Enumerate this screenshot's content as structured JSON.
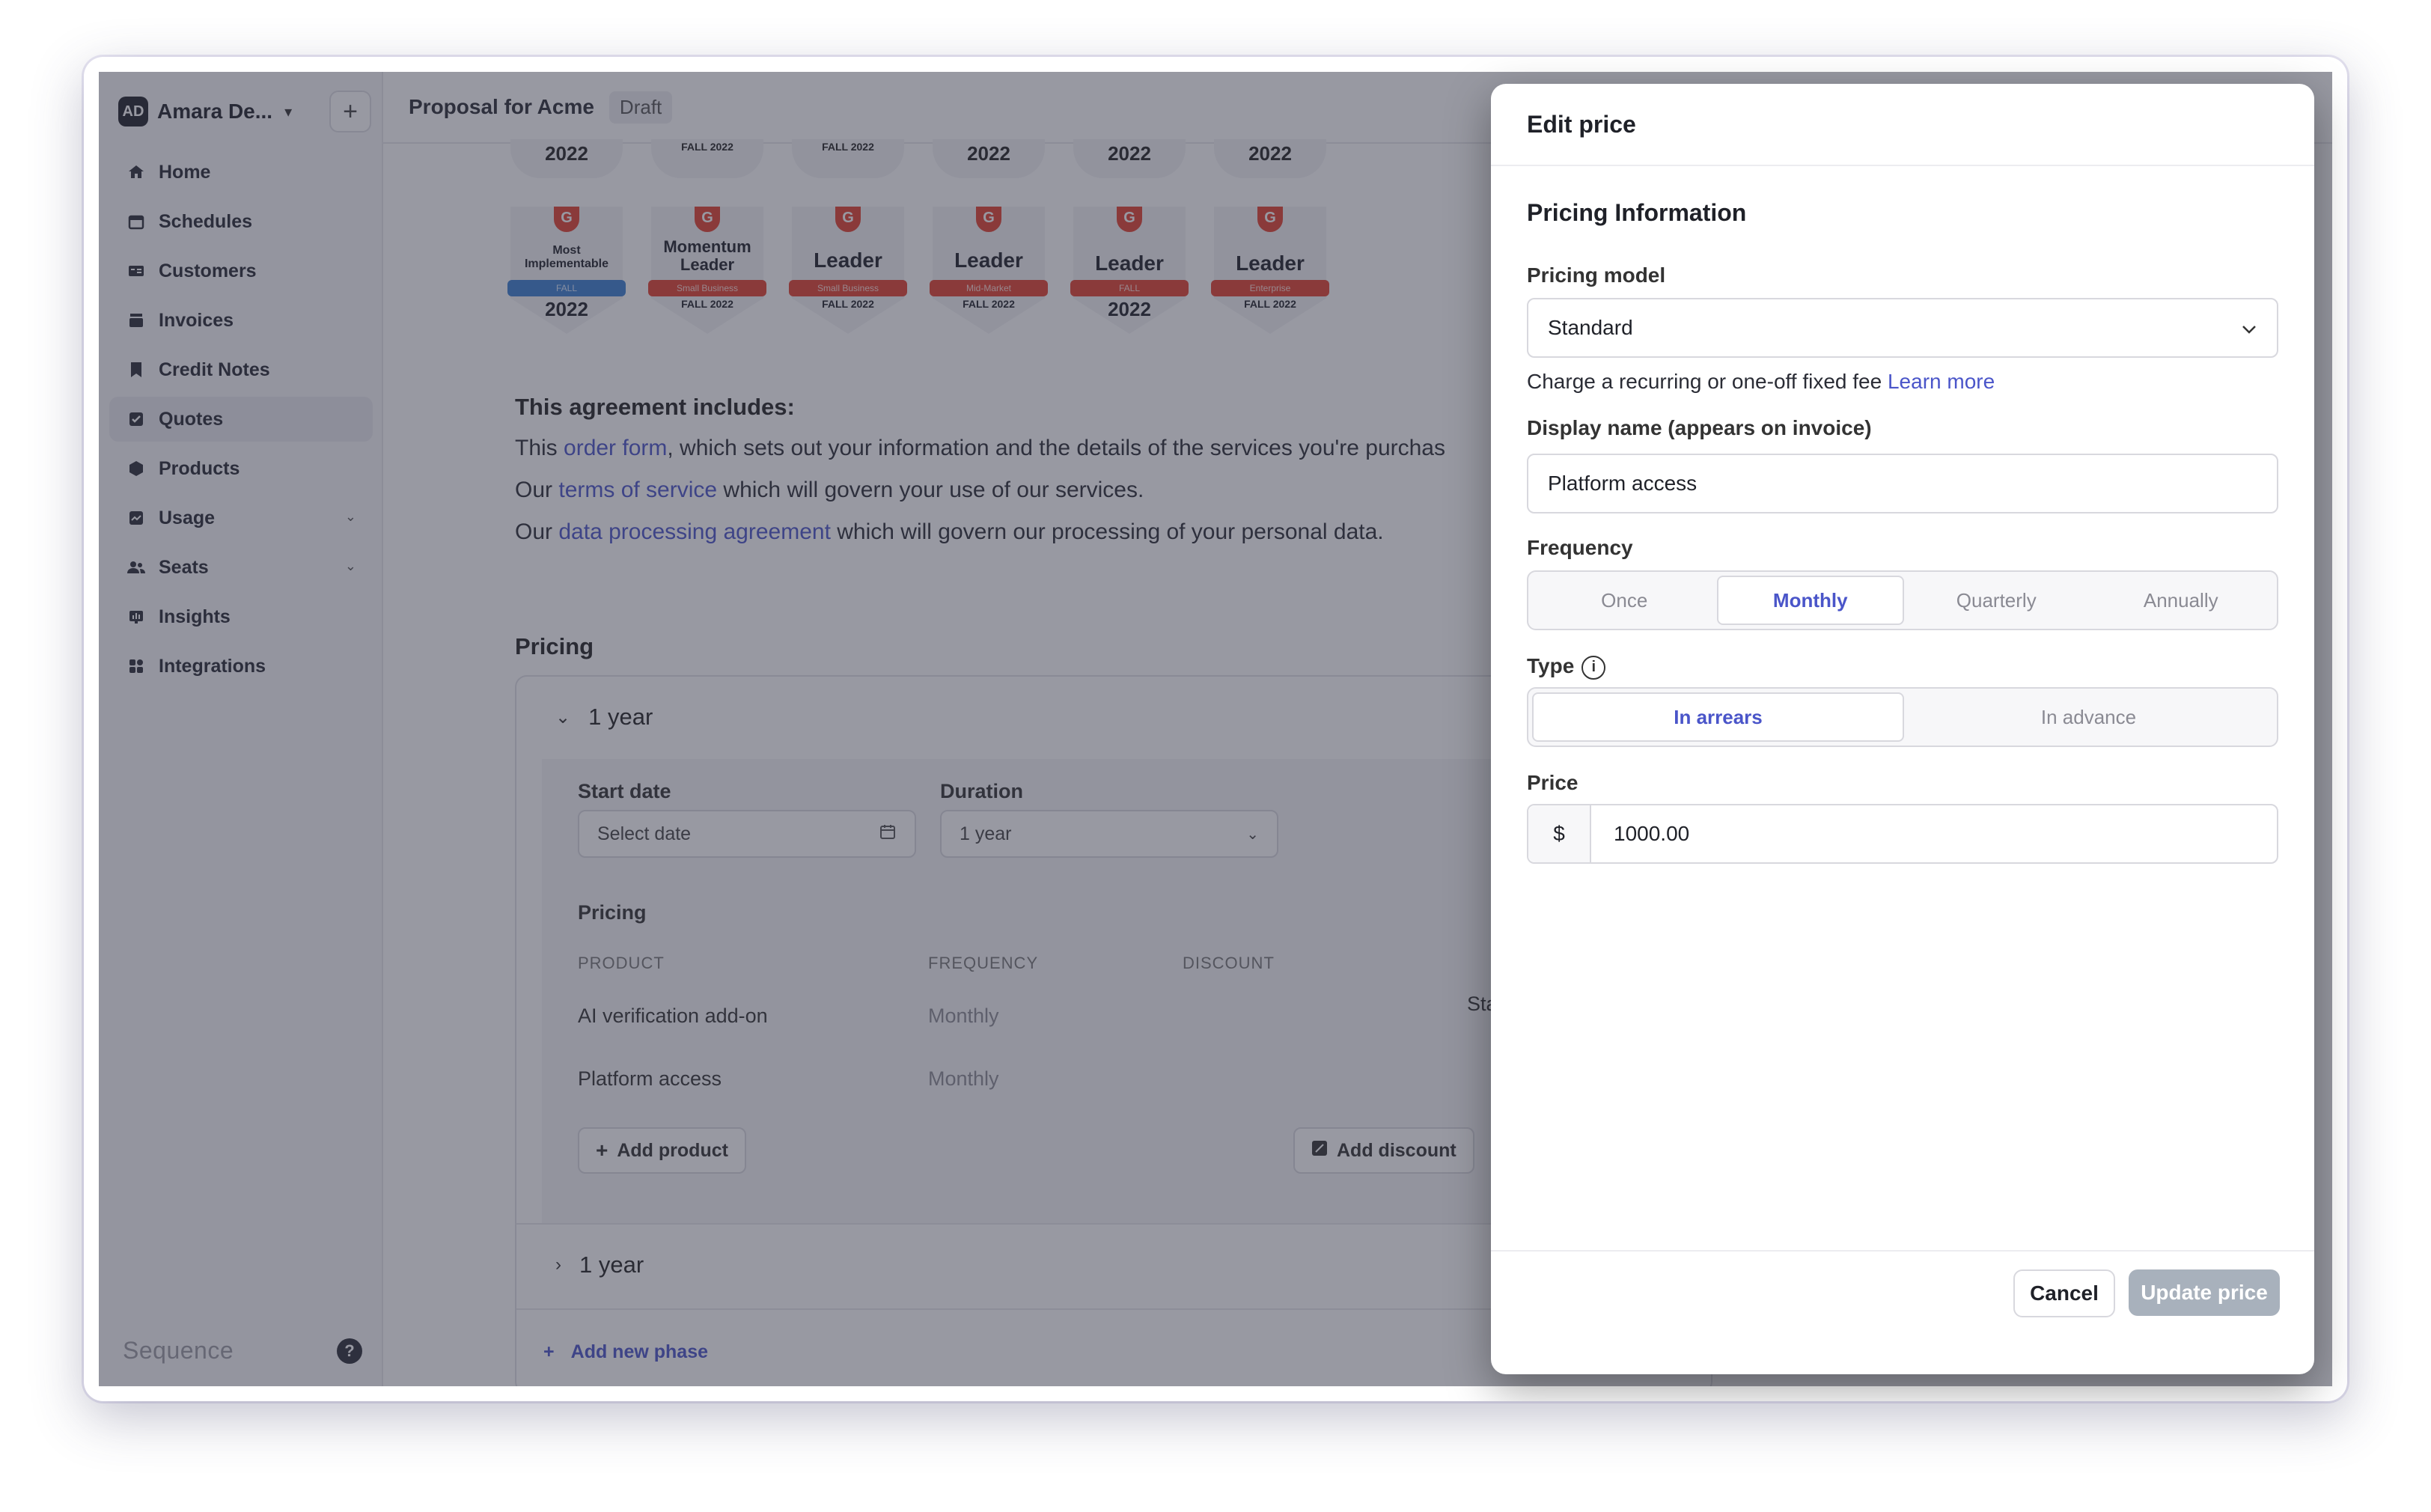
{
  "workspace": {
    "avatar": "AD",
    "name": "Amara De..."
  },
  "sidebar": {
    "items": [
      {
        "label": "Home",
        "icon": "home-icon"
      },
      {
        "label": "Schedules",
        "icon": "calendar-icon"
      },
      {
        "label": "Customers",
        "icon": "id-card-icon"
      },
      {
        "label": "Invoices",
        "icon": "invoice-icon"
      },
      {
        "label": "Credit Notes",
        "icon": "note-icon"
      },
      {
        "label": "Quotes",
        "icon": "checkbox-icon"
      },
      {
        "label": "Products",
        "icon": "cube-icon"
      },
      {
        "label": "Usage",
        "icon": "chart-icon"
      },
      {
        "label": "Seats",
        "icon": "users-icon"
      },
      {
        "label": "Insights",
        "icon": "insights-icon"
      },
      {
        "label": "Integrations",
        "icon": "grid-icon"
      }
    ],
    "brand": "Sequence",
    "help": "?"
  },
  "header": {
    "title": "Proposal for Acme",
    "status": "Draft"
  },
  "badges_top": [
    "2022",
    "FALL 2022",
    "FALL 2022",
    "2022",
    "2022",
    "2022"
  ],
  "badges": [
    {
      "name": "Most Implementable",
      "ribbon": "FALL",
      "year": "2022"
    },
    {
      "name": "Momentum Leader",
      "ribbon": "Small Business",
      "year": "FALL 2022"
    },
    {
      "name": "Leader",
      "ribbon": "Small Business",
      "year": "FALL 2022"
    },
    {
      "name": "Leader",
      "ribbon": "Mid-Market",
      "year": "FALL 2022"
    },
    {
      "name": "Leader",
      "ribbon": "FALL",
      "year": "2022"
    },
    {
      "name": "Leader",
      "ribbon": "Enterprise",
      "year": "FALL 2022"
    }
  ],
  "agreement": {
    "heading": "This agreement includes:",
    "line1_pre": "This ",
    "line1_link": "order form",
    "line1_post": ", which sets out your information and the details of the services you're purchas",
    "line2_pre": "Our ",
    "line2_link": "terms of service",
    "line2_post": " which will govern your use of our services.",
    "line3_pre": "Our ",
    "line3_link": "data processing agreement",
    "line3_post": " which will govern our processing of your personal data."
  },
  "pricing": {
    "heading": "Pricing",
    "phase1": "1 year",
    "start_label": "Start date",
    "start_placeholder": "Select date",
    "duration_label": "Duration",
    "duration_value": "1 year",
    "sub_heading": "Pricing",
    "columns": [
      "PRODUCT",
      "FREQUENCY",
      "DISCOUNT"
    ],
    "rows": [
      {
        "product": "AI verification add-on",
        "frequency": "Monthly"
      },
      {
        "product": "Platform access",
        "frequency": "Monthly"
      }
    ],
    "starts_text": "Starts f",
    "add_product": "Add product",
    "add_discount": "Add discount",
    "phase2": "1 year",
    "add_phase": "Add new phase"
  },
  "modal": {
    "title": "Edit price",
    "section": "Pricing Information",
    "pricing_model_label": "Pricing model",
    "pricing_model_value": "Standard",
    "help_text": "Charge a recurring or one-off fixed fee ",
    "help_link": "Learn more",
    "display_name_label": "Display name (appears on invoice)",
    "display_name_value": "Platform access",
    "frequency_label": "Frequency",
    "frequency_options": [
      "Once",
      "Monthly",
      "Quarterly",
      "Annually"
    ],
    "frequency_selected": "Monthly",
    "type_label": "Type",
    "type_options": [
      "In arrears",
      "In advance"
    ],
    "type_selected": "In arrears",
    "price_label": "Price",
    "currency": "$",
    "price_value": "1000.00",
    "cancel": "Cancel",
    "update": "Update price"
  }
}
